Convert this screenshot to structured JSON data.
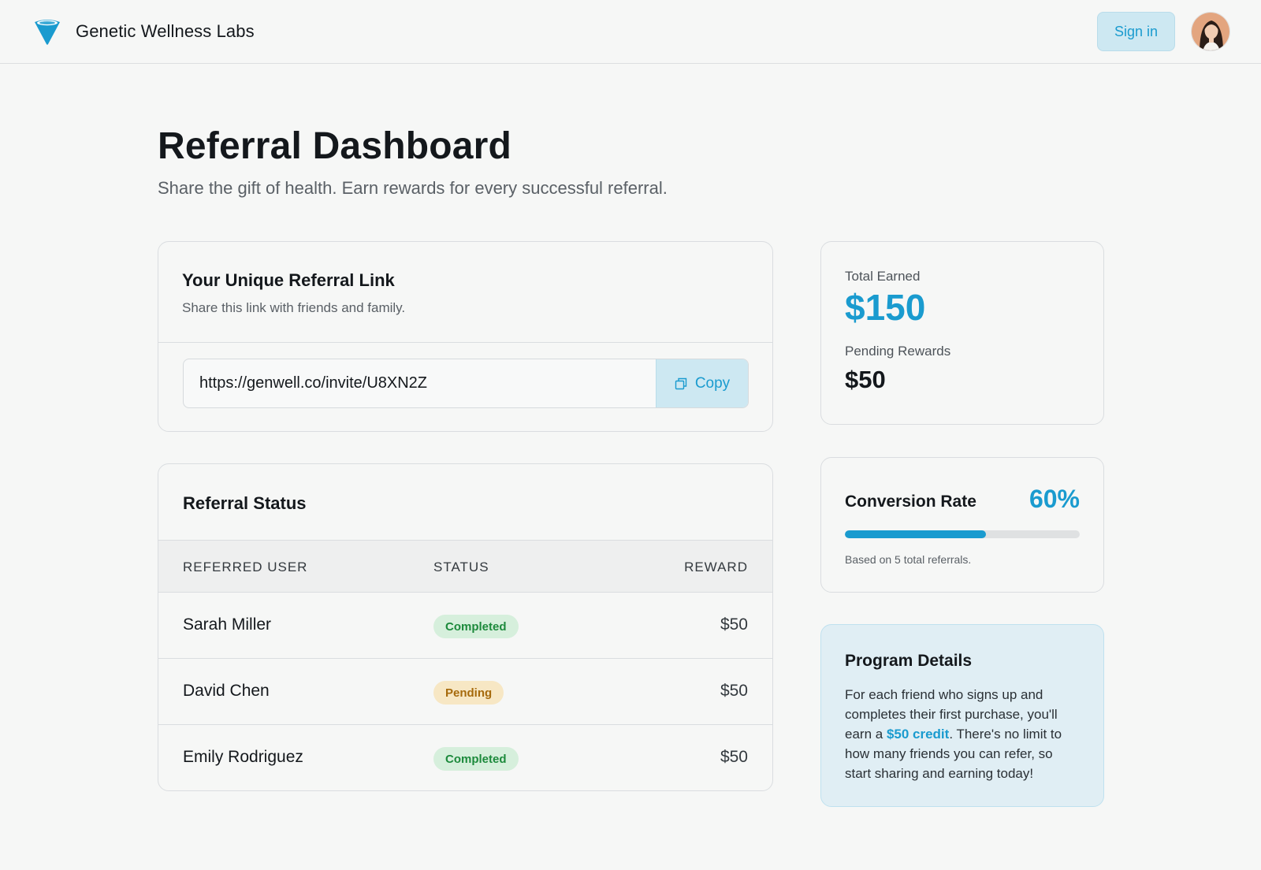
{
  "header": {
    "brand_name": "Genetic Wellness Labs",
    "sign_in_label": "Sign in"
  },
  "page": {
    "title": "Referral Dashboard",
    "subtitle": "Share the gift of health. Earn rewards for every successful referral."
  },
  "referral_link": {
    "title": "Your Unique Referral Link",
    "subtitle": "Share this link with friends and family.",
    "url": "https://genwell.co/invite/U8XN2Z",
    "copy_label": "Copy"
  },
  "referral_status": {
    "title": "Referral Status",
    "columns": [
      "REFERRED USER",
      "STATUS",
      "REWARD"
    ],
    "rows": [
      {
        "name": "Sarah Miller",
        "status": "Completed",
        "reward": "$50"
      },
      {
        "name": "David Chen",
        "status": "Pending",
        "reward": "$50"
      },
      {
        "name": "Emily Rodriguez",
        "status": "Completed",
        "reward": "$50"
      }
    ]
  },
  "earnings": {
    "total_label": "Total Earned",
    "total_value": "$150",
    "pending_label": "Pending Rewards",
    "pending_value": "$50"
  },
  "conversion": {
    "title": "Conversion Rate",
    "value": "60%",
    "progress": 0.6,
    "note": "Based on 5 total referrals."
  },
  "program": {
    "title": "Program Details",
    "text_before": "For each friend who signs up and completes their first purchase, you'll earn a ",
    "highlight": "$50 credit",
    "text_after": ". There's no limit to how many friends you can refer, so start sharing and earning today!"
  },
  "colors": {
    "accent": "#1a9bcf",
    "completed_bg": "#d6efdc",
    "completed_text": "#1d8a3c",
    "pending_bg": "#f7e7c4",
    "pending_text": "#a66a0c"
  },
  "icons": {
    "logo": "funnel-logo-icon",
    "copy": "copy-icon",
    "avatar": "user-avatar"
  }
}
